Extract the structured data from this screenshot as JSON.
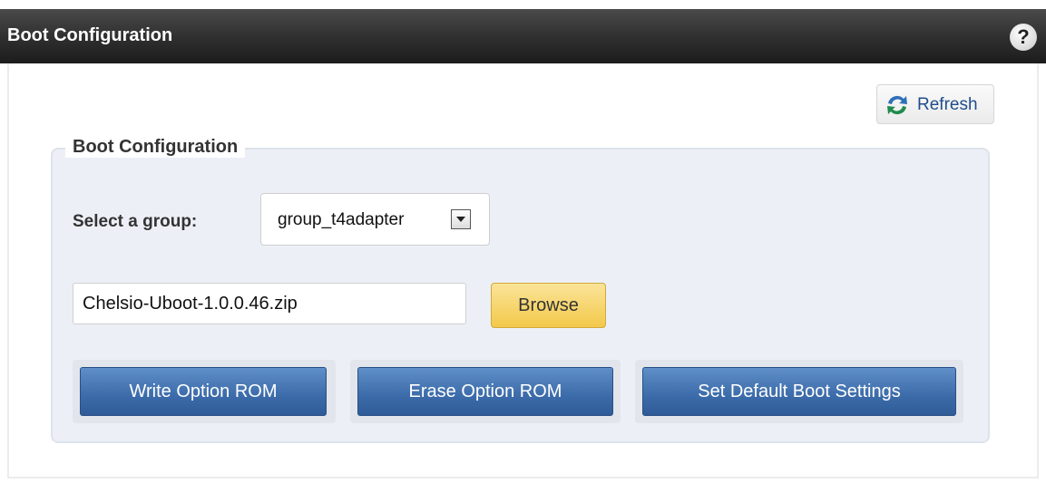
{
  "header": {
    "title": "Boot Configuration",
    "help_icon": "?"
  },
  "toolbar": {
    "refresh_label": "Refresh",
    "refresh_icon": "refresh-icon"
  },
  "boot_config": {
    "legend": "Boot Configuration",
    "group_label": "Select a group:",
    "group_value": "group_t4adapter",
    "file_value": "Chelsio-Uboot-1.0.0.46.zip",
    "browse_label": "Browse",
    "actions": {
      "write_label": "Write Option ROM",
      "erase_label": "Erase Option ROM",
      "defaults_label": "Set Default Boot Settings"
    }
  },
  "colors": {
    "header_bg": "#2e2e2e",
    "panel_bg": "#ecf0f6",
    "primary_button": "#3c6ba9",
    "browse_button": "#f3c94a",
    "refresh_text": "#1f4d8c"
  }
}
